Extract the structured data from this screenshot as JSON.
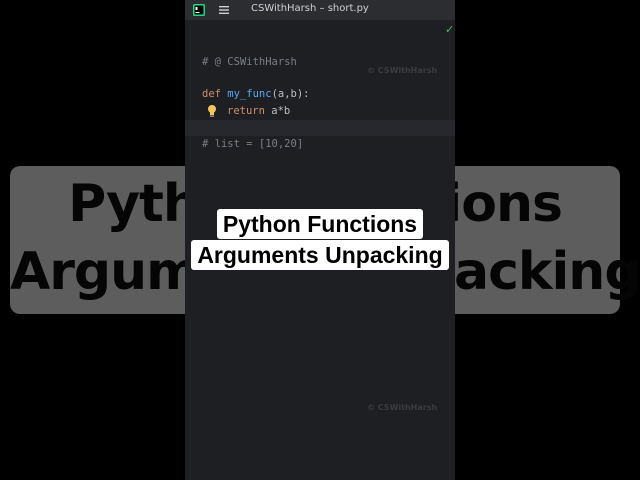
{
  "background_caption": {
    "line1": "Python Functions",
    "line2": "Arguments Unpacking"
  },
  "editor": {
    "title": "CSWithHarsh – short.py",
    "app_icon": "pycharm-icon",
    "menu_icon": "hamburger-menu-icon",
    "status_icon": "checkmark-icon",
    "code": {
      "line1_comment": "# @ CSWithHarsh",
      "line2_def": "def",
      "line2_fn": "my_func",
      "line2_rest": "(a,b):",
      "line3_return": "return",
      "line3_rest": "a*b",
      "bulb_icon": "lightbulb-icon",
      "line4_comment": "# list = [10,20]"
    },
    "watermark_top": "© CSWithHarsh",
    "watermark_bottom": "© CSWithHarsh"
  },
  "caption": {
    "line1": "Python Functions",
    "line2": "Arguments Unpacking"
  },
  "colors": {
    "editor_bg": "#1e1f22",
    "keyword": "#cf8e6d",
    "function": "#56a8f5",
    "comment": "#7a7e85",
    "check": "#5fb865"
  }
}
